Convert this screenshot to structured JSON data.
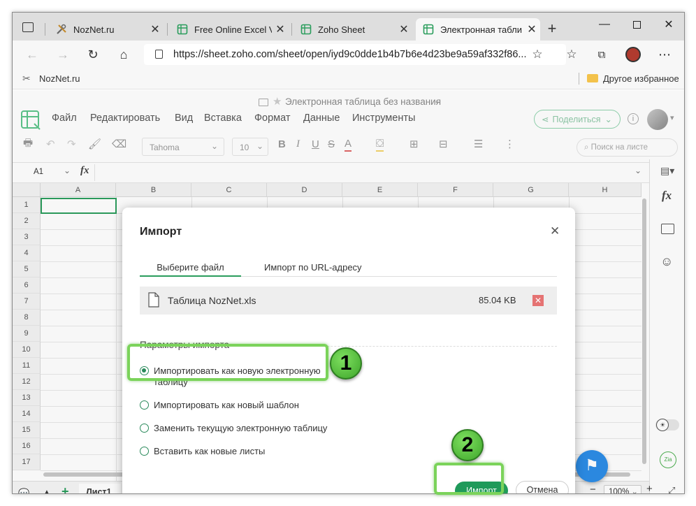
{
  "browser": {
    "tabs": [
      {
        "label": "NozNet.ru",
        "icon": "tools-icon"
      },
      {
        "label": "Free Online Excel Vie",
        "icon": "zoho-sheet-icon"
      },
      {
        "label": "Zoho Sheet",
        "icon": "zoho-sheet-icon"
      },
      {
        "label": "Электронная табли",
        "icon": "zoho-sheet-icon"
      }
    ],
    "url": "https://sheet.zoho.com/sheet/open/iyd9c0dde1b4b7b6e4d23be9a59af332f86...",
    "favorites": {
      "bookmark": "NozNet.ru",
      "other": "Другое избранное"
    }
  },
  "app": {
    "doc_title": "Электронная таблица без названия",
    "menu": [
      "Файл",
      "Редактировать",
      "Вид",
      "Вставка",
      "Формат",
      "Данные",
      "Инструменты"
    ],
    "share_label": "Поделиться",
    "font_name": "Tahoma",
    "font_size": "10",
    "search_placeholder": "Поиск на листе",
    "cell_ref": "A1",
    "fx_label": "fx",
    "columns": [
      "A",
      "B",
      "C",
      "D",
      "E",
      "F",
      "G",
      "H"
    ],
    "rows": [
      "1",
      "2",
      "3",
      "4",
      "5",
      "6",
      "7",
      "8",
      "9",
      "10",
      "11",
      "12",
      "13",
      "14",
      "15",
      "16",
      "17"
    ],
    "sheet_tab": "Лист1",
    "zoom": "100%"
  },
  "dialog": {
    "title": "Импорт",
    "tabs": [
      "Выберите файл",
      "Импорт по URL-адресу"
    ],
    "file_name": "Таблица NozNet.xls",
    "file_size": "85.04 KB",
    "section": "Параметры импорта",
    "options": [
      {
        "label": "Импортировать как новую электронную таблицу",
        "selected": true
      },
      {
        "label": "Импортировать как новый шаблон",
        "selected": false
      },
      {
        "label": "Заменить текущую электронную таблицу",
        "selected": false
      },
      {
        "label": "Вставить как новые листы",
        "selected": false
      }
    ],
    "option1_line1": "Импортировать как новую электронную",
    "option1_line2": "таблицу",
    "import_button": "Импорт",
    "cancel_button": "Отмена"
  },
  "annotations": {
    "step1": "1",
    "step2": "2",
    "highlight_color": "#7bd35a"
  }
}
